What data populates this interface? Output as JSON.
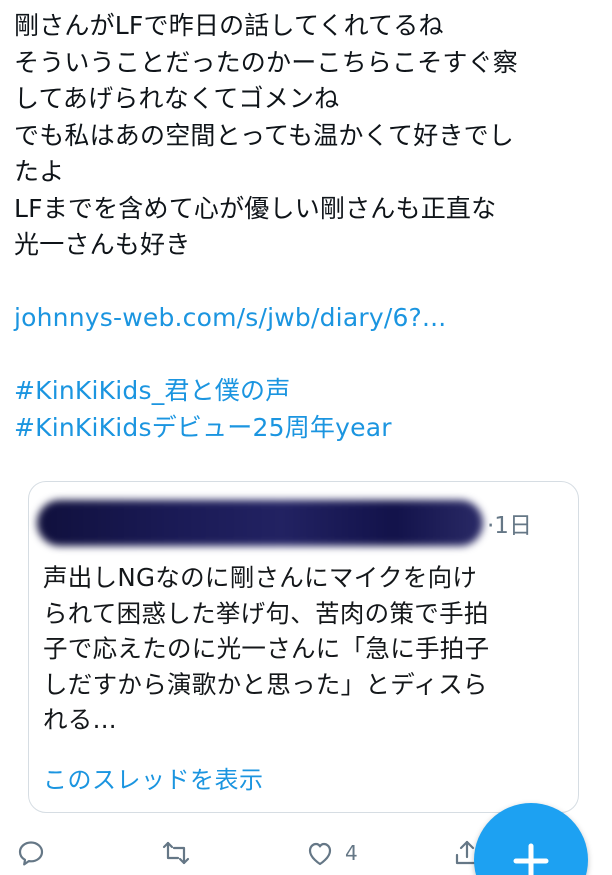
{
  "tweet": {
    "lines": [
      "剛さんがLFで昨日の話してくれてるね",
      "そういうことだったのかーこちらこそすぐ察",
      "してあげられなくてゴメンね",
      "でも私はあの空間とっても温かくて好きでし",
      "たよ",
      "LFまでを含めて心が優しい剛さんも正直な",
      "光一さんも好き"
    ],
    "link": "johnnys-web.com/s/jwb/diary/6?...",
    "hashtags": [
      "#KinKiKids_君と僕の声",
      "#KinKiKidsデビュー25周年year"
    ]
  },
  "quote": {
    "time": "·1日",
    "lines": [
      "声出しNGなのに剛さんにマイクを向け",
      "られて困惑した挙げ句、苦肉の策で手拍",
      "子で応えたのに光一さんに「急に手拍子",
      "しだすから演歌かと思った」とディスら",
      "れる..."
    ],
    "thread_link": "このスレッドを表示"
  },
  "actions": {
    "like_count": "4",
    "icons": [
      "reply-icon",
      "retweet-icon",
      "like-icon",
      "share-icon"
    ],
    "fab_icon": "compose-plus-icon"
  },
  "colors": {
    "link": "#1b95e0",
    "fab": "#1da1f2",
    "muted": "#657786",
    "border": "#d6dde3"
  }
}
